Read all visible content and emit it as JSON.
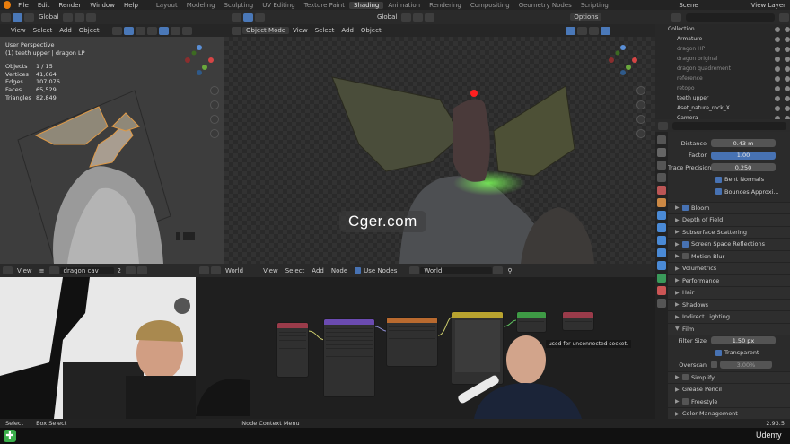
{
  "menu": {
    "items": [
      "File",
      "Edit",
      "Render",
      "Window",
      "Help"
    ],
    "workspaces": [
      "Layout",
      "Modeling",
      "Sculpting",
      "UV Editing",
      "Texture Paint",
      "Shading",
      "Animation",
      "Rendering",
      "Compositing",
      "Geometry Nodes",
      "Scripting"
    ],
    "active_workspace": "Shading",
    "scene_label": "Scene",
    "view_layer_label": "View Layer"
  },
  "left_viewport": {
    "orientation": "Global",
    "menus": [
      "View",
      "Select",
      "Add",
      "Object"
    ],
    "title": "User Perspective",
    "subtitle": "(1) teeth upper | dragon LP",
    "stats": [
      {
        "label": "Objects",
        "value": "1 / 15"
      },
      {
        "label": "Vertices",
        "value": "41,664"
      },
      {
        "label": "Edges",
        "value": "107,076"
      },
      {
        "label": "Faces",
        "value": "65,529"
      },
      {
        "label": "Triangles",
        "value": "82,849"
      }
    ]
  },
  "main_viewport": {
    "orientation": "Global",
    "mode": "Object Mode",
    "menus": [
      "View",
      "Select",
      "Add",
      "Object"
    ],
    "options_label": "Options"
  },
  "watermark": "Cger.com",
  "outliner": {
    "search_placeholder": "",
    "rows": [
      {
        "name": "Collection",
        "dim": false
      },
      {
        "name": "Armature",
        "dim": false
      },
      {
        "name": "dragon HP",
        "dim": true
      },
      {
        "name": "dragon original",
        "dim": true
      },
      {
        "name": "dragon quadrement",
        "dim": true
      },
      {
        "name": "reference",
        "dim": true
      },
      {
        "name": "retopo",
        "dim": true
      },
      {
        "name": "teeth upper",
        "dim": false
      },
      {
        "name": "Aset_nature_rock_X",
        "dim": false
      },
      {
        "name": "Camera",
        "dim": false
      }
    ]
  },
  "properties": {
    "ao_fields": [
      {
        "label": "Distance",
        "value": "0.43 m",
        "highlight": false
      },
      {
        "label": "Factor",
        "value": "1.00",
        "highlight": true
      },
      {
        "label": "Trace Precision",
        "value": "0.250",
        "highlight": false
      }
    ],
    "ao_checks": [
      {
        "label": "Bent Normals",
        "checked": true
      },
      {
        "label": "Bounces Approxi...",
        "checked": true
      }
    ],
    "panels": [
      {
        "label": "Bloom",
        "checkbox": true,
        "expanded": false
      },
      {
        "label": "Depth of Field",
        "checkbox": false,
        "expanded": false
      },
      {
        "label": "Subsurface Scattering",
        "checkbox": false,
        "expanded": false
      },
      {
        "label": "Screen Space Reflections",
        "checkbox": true,
        "expanded": false
      },
      {
        "label": "Motion Blur",
        "checkbox": false,
        "expanded": false
      },
      {
        "label": "Volumetrics",
        "checkbox": false,
        "expanded": false
      },
      {
        "label": "Performance",
        "checkbox": false,
        "expanded": false
      },
      {
        "label": "Hair",
        "checkbox": false,
        "expanded": false
      },
      {
        "label": "Shadows",
        "checkbox": false,
        "expanded": false
      },
      {
        "label": "Indirect Lighting",
        "checkbox": false,
        "expanded": false
      },
      {
        "label": "Film",
        "checkbox": false,
        "expanded": true
      }
    ],
    "film": {
      "filter_size_label": "Filter Size",
      "filter_size_value": "1.50 px",
      "transparent_label": "Transparent",
      "overscan_label": "Overscan",
      "overscan_value": "3.00%"
    },
    "bottom_panels": [
      {
        "label": "Simplify",
        "checkbox": true
      },
      {
        "label": "Grease Pencil",
        "checkbox": false
      },
      {
        "label": "Freestyle",
        "checkbox": true
      },
      {
        "label": "Color Management",
        "checkbox": false
      }
    ]
  },
  "image_editor": {
    "view_label": "View",
    "image_name": "dragon cav",
    "slot": "2"
  },
  "node_editor": {
    "world_label": "World",
    "menus": [
      "View",
      "Select",
      "Add",
      "Node"
    ],
    "use_nodes_label": "Use Nodes",
    "world_name": "World",
    "tooltip": "used for unconnected socket."
  },
  "statusbar": {
    "left": [
      "Select",
      "Box Select"
    ],
    "center": "Node Context Menu",
    "version": "2.93.5"
  },
  "footer": {
    "brand": "Udemy"
  },
  "colors": {
    "accent": "#4772b3",
    "orange": "#e87d0d",
    "green_logo": "#3aae4a"
  }
}
